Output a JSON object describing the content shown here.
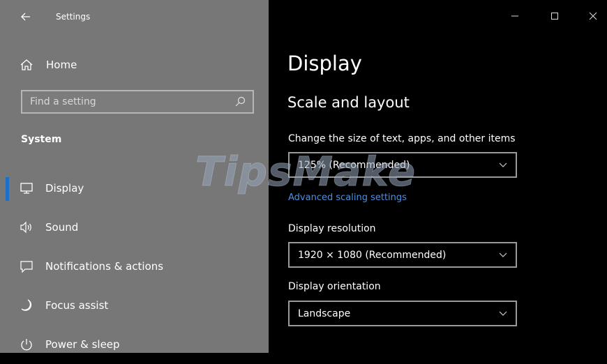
{
  "window": {
    "title": "Settings",
    "controls": {
      "minimize": "minimize-icon",
      "maximize": "maximize-icon",
      "close": "close-icon"
    }
  },
  "sidebar": {
    "home_label": "Home",
    "search_placeholder": "Find a setting",
    "section_heading": "System",
    "items": [
      {
        "label": "Display",
        "icon": "monitor-icon",
        "selected": true
      },
      {
        "label": "Sound",
        "icon": "speaker-icon",
        "selected": false
      },
      {
        "label": "Notifications & actions",
        "icon": "notification-icon",
        "selected": false
      },
      {
        "label": "Focus assist",
        "icon": "moon-icon",
        "selected": false
      },
      {
        "label": "Power & sleep",
        "icon": "power-icon",
        "selected": false
      }
    ]
  },
  "content": {
    "page_title": "Display",
    "section_title": "Scale and layout",
    "scale": {
      "label": "Change the size of text, apps, and other items",
      "value": "125% (Recommended)"
    },
    "advanced_link": "Advanced scaling settings",
    "resolution": {
      "label": "Display resolution",
      "value": "1920 × 1080 (Recommended)"
    },
    "orientation": {
      "label": "Display orientation",
      "value": "Landscape"
    }
  },
  "watermark": {
    "text": "TipsMake"
  },
  "colors": {
    "sidebar_bg": "#777777",
    "content_bg": "#000000",
    "accent": "#1a6fc9",
    "link": "#4f8fde"
  }
}
